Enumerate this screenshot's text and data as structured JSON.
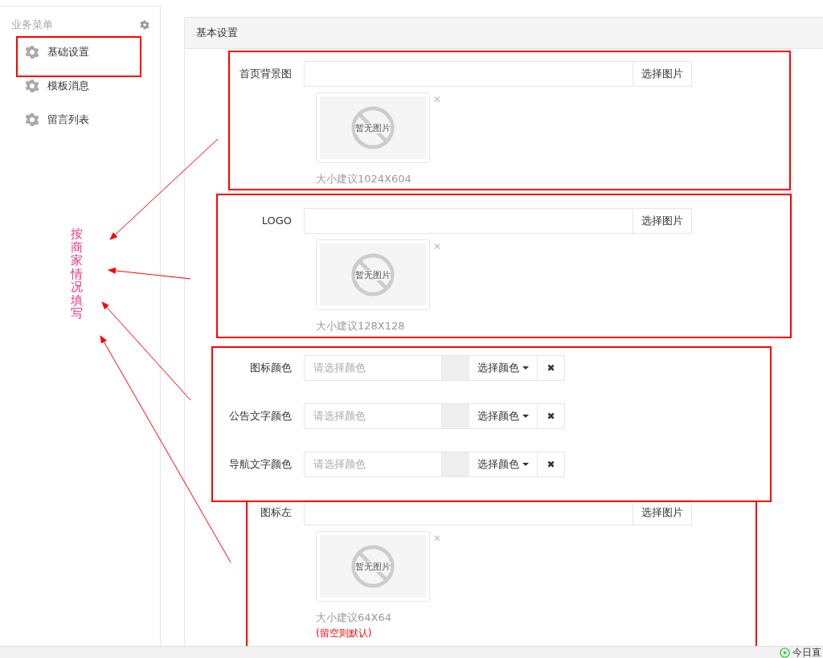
{
  "sidebar": {
    "title": "业务菜单",
    "items": [
      {
        "label": "基础设置"
      },
      {
        "label": "模板消息"
      },
      {
        "label": "留言列表"
      }
    ]
  },
  "panel": {
    "title": "基本设置",
    "fields": [
      {
        "kind": "image",
        "label": "首页背景图",
        "button": "选择图片",
        "empty_text": "暂无图片",
        "remove": "✕",
        "hint": "大小建议1024X604"
      },
      {
        "kind": "image",
        "label": "LOGO",
        "button": "选择图片",
        "empty_text": "暂无图片",
        "remove": "✕",
        "hint": "大小建议128X128"
      },
      {
        "kind": "color",
        "label": "图标颜色",
        "placeholder": "请选择颜色",
        "button": "选择颜色",
        "clear": "✖"
      },
      {
        "kind": "color",
        "label": "公告文字颜色",
        "placeholder": "请选择颜色",
        "button": "选择颜色",
        "clear": "✖"
      },
      {
        "kind": "color",
        "label": "导航文字颜色",
        "placeholder": "请选择颜色",
        "button": "选择颜色",
        "clear": "✖"
      },
      {
        "kind": "image",
        "label": "图标左",
        "button": "选择图片",
        "empty_text": "暂无图片",
        "remove": "✕",
        "hint": "大小建议64X64",
        "note": "(留空则默认)"
      }
    ]
  },
  "annotation": {
    "text": "按商家情况填写"
  },
  "status_bar": {
    "text": "今日直"
  }
}
